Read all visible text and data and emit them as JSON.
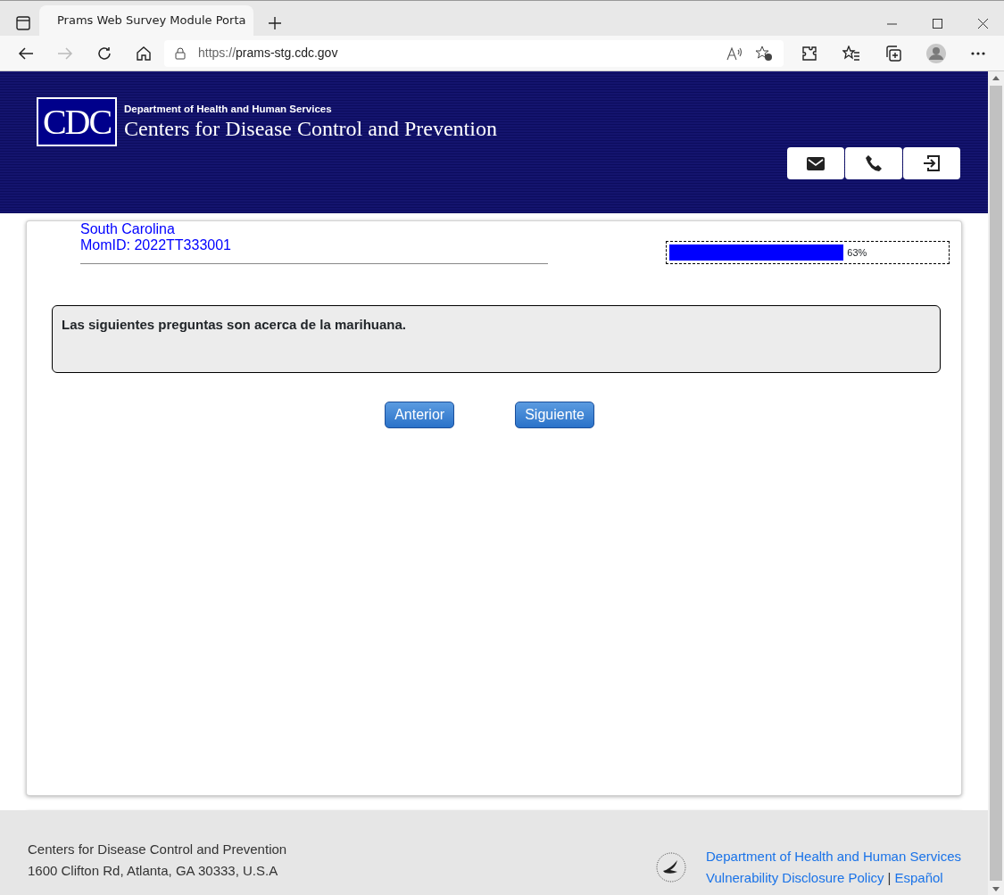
{
  "browser": {
    "tab_title": "Prams Web Survey Module Porta",
    "url_prefix": "https://",
    "url_host": "prams-stg.cdc.gov"
  },
  "header": {
    "logo_text": "CDC",
    "department": "Department of Health and Human Services",
    "agency": "Centers for Disease Control and Prevention"
  },
  "respondent": {
    "state": "South Carolina",
    "mom_id": "MomID: 2022TT333001"
  },
  "progress": {
    "level": 0.63,
    "reading": "63%"
  },
  "question": "Las siguientes preguntas son acerca de la marihuana.",
  "nav_buttons": [
    "Anterior",
    "Siguiente"
  ],
  "footer": {
    "org": "Centers for Disease Control and Prevention",
    "address": "1600 Clifton Rd, Atlanta, GA 30333, U.S.A",
    "links": [
      "Department of Health and Human Services",
      "Vulnerability Disclosure Policy",
      "Español"
    ],
    "separator": "|"
  }
}
